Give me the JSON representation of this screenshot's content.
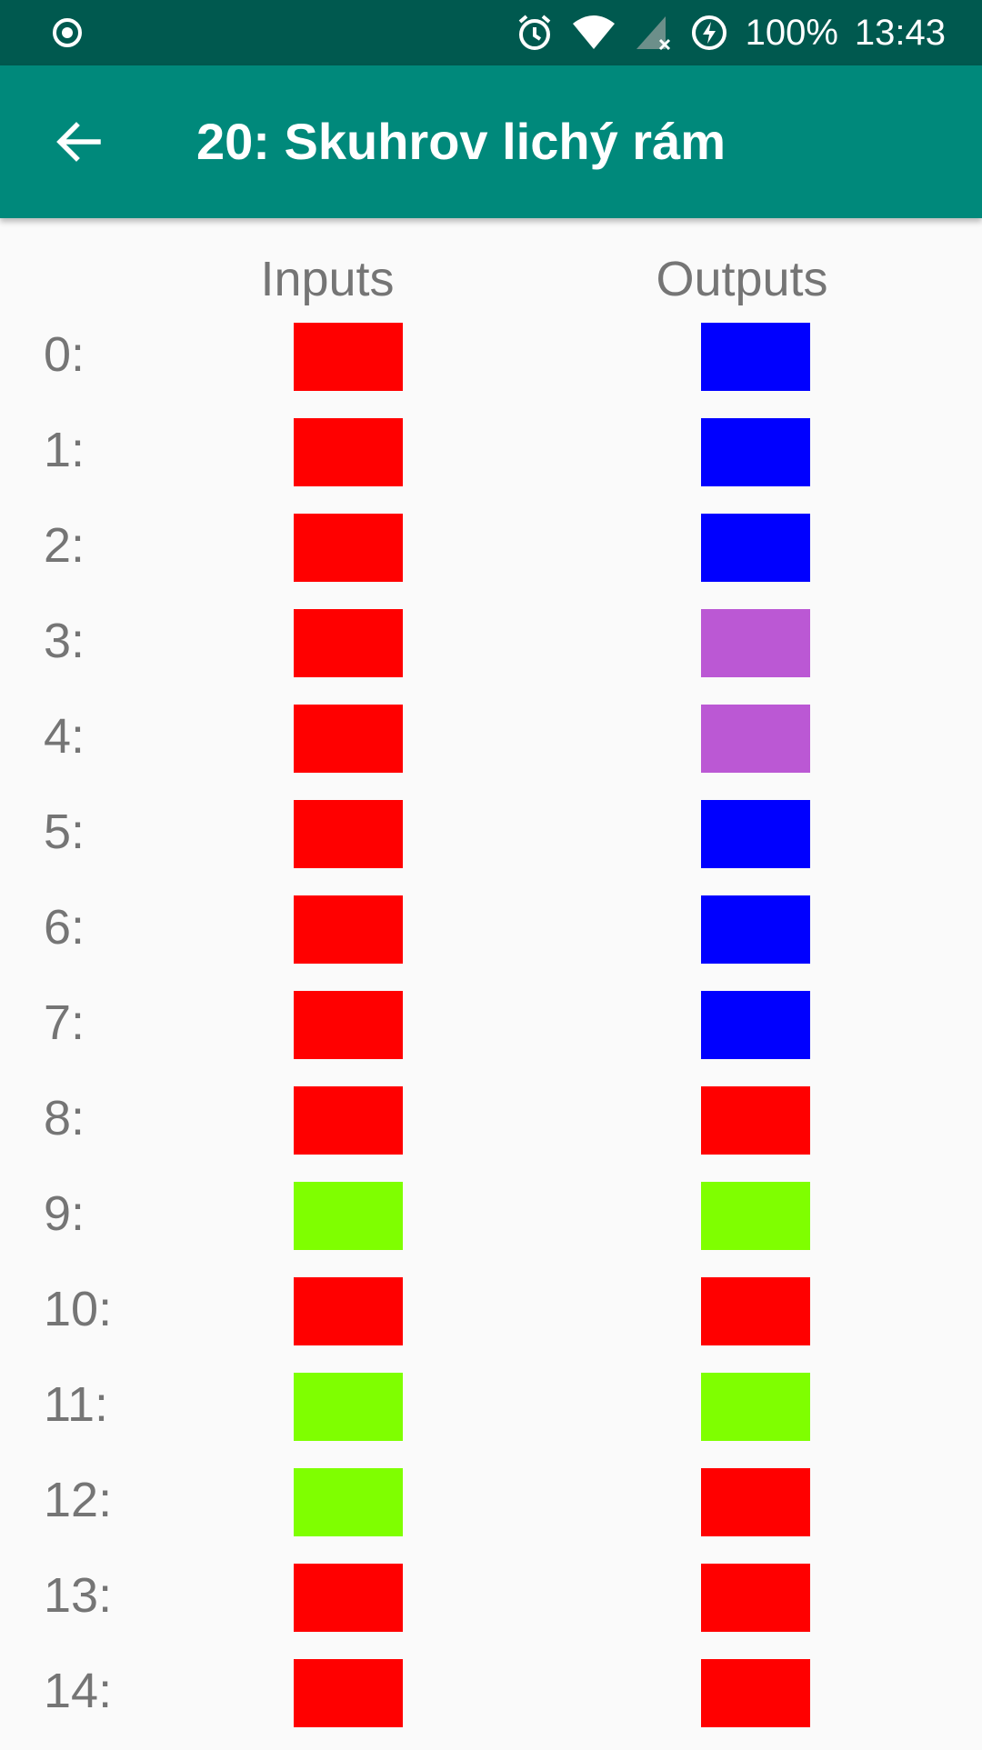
{
  "status_bar": {
    "battery": "100%",
    "time": "13:43",
    "icons": [
      "record-icon",
      "alarm-icon",
      "wifi-icon",
      "signal-icon",
      "battery-saver-icon"
    ]
  },
  "app_bar": {
    "title": "20: Skuhrov lichý rám",
    "back_icon": "arrow-back-icon"
  },
  "columns": {
    "inputs": "Inputs",
    "outputs": "Outputs"
  },
  "colors": {
    "red": "#ff0000",
    "blue": "#0000ff",
    "purple": "#bb58d4",
    "green": "#7fff00"
  },
  "rows": [
    {
      "label": "0:",
      "input": "red",
      "output": "blue"
    },
    {
      "label": "1:",
      "input": "red",
      "output": "blue"
    },
    {
      "label": "2:",
      "input": "red",
      "output": "blue"
    },
    {
      "label": "3:",
      "input": "red",
      "output": "purple"
    },
    {
      "label": "4:",
      "input": "red",
      "output": "purple"
    },
    {
      "label": "5:",
      "input": "red",
      "output": "blue"
    },
    {
      "label": "6:",
      "input": "red",
      "output": "blue"
    },
    {
      "label": "7:",
      "input": "red",
      "output": "blue"
    },
    {
      "label": "8:",
      "input": "red",
      "output": "red"
    },
    {
      "label": "9:",
      "input": "green",
      "output": "green"
    },
    {
      "label": "10:",
      "input": "red",
      "output": "red"
    },
    {
      "label": "11:",
      "input": "green",
      "output": "green"
    },
    {
      "label": "12:",
      "input": "green",
      "output": "red"
    },
    {
      "label": "13:",
      "input": "red",
      "output": "red"
    },
    {
      "label": "14:",
      "input": "red",
      "output": "red"
    }
  ]
}
